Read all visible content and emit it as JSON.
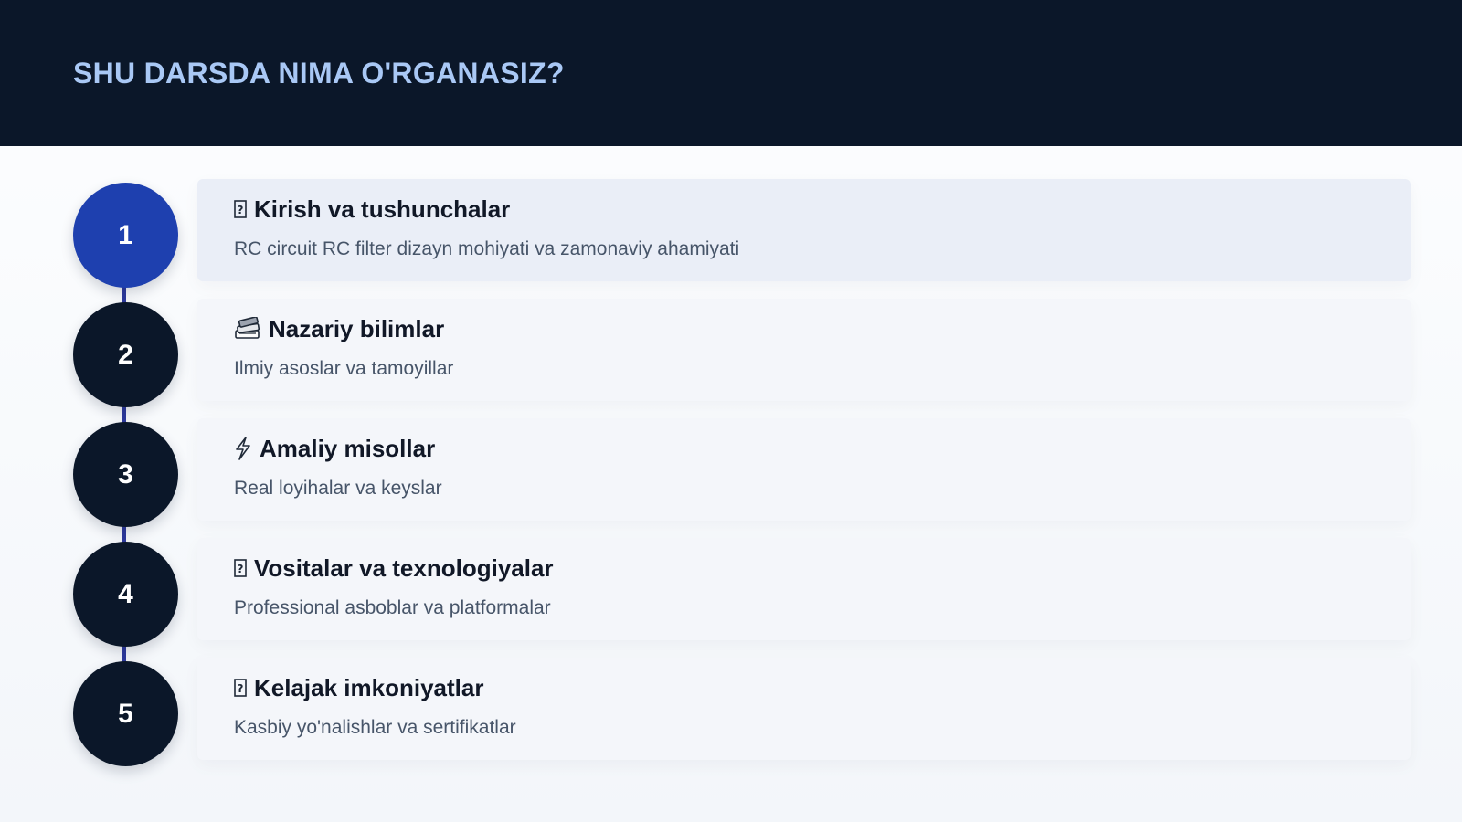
{
  "slide": {
    "title": "SHU DARSDA NIMA O'RGANASIZ?"
  },
  "colors": {
    "header_bg": "#0b1729",
    "title": "#a9c8f5",
    "active_step": "#1e40af",
    "inactive_step": "#0b1729",
    "timeline": "#2e3a9e",
    "active_card": "#eaeef7",
    "card": "#f4f6fa"
  },
  "steps": [
    {
      "number": "1",
      "icon": "missing-glyph-icon",
      "title": "Kirish va tushunchalar",
      "description": "RC circuit RC filter dizayn mohiyati va zamonaviy ahamiyati",
      "active": true
    },
    {
      "number": "2",
      "icon": "books-icon",
      "title": "Nazariy bilimlar",
      "description": "Ilmiy asoslar va tamoyillar",
      "active": false
    },
    {
      "number": "3",
      "icon": "lightning-icon",
      "title": "Amaliy misollar",
      "description": "Real loyihalar va keyslar",
      "active": false
    },
    {
      "number": "4",
      "icon": "missing-glyph-icon",
      "title": "Vositalar va texnologiyalar",
      "description": "Professional asboblar va platformalar",
      "active": false
    },
    {
      "number": "5",
      "icon": "missing-glyph-icon",
      "title": "Kelajak imkoniyatlar",
      "description": "Kasbiy yo'nalishlar va sertifikatlar",
      "active": false
    }
  ]
}
